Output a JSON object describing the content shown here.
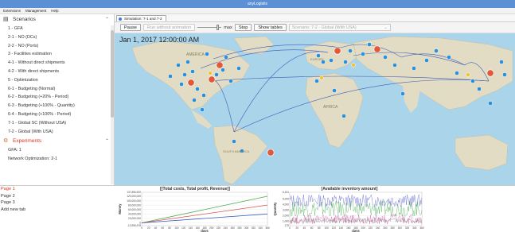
{
  "window": {
    "title": "anyLogistix"
  },
  "menu": [
    "Extensions",
    "Management",
    "Help"
  ],
  "sidebar": {
    "scenarios_header": "Scenarios",
    "scenarios": [
      "1 - GFA",
      "2-1 - NO (DCs)",
      "2-2 - NO (Ports)",
      "3 - Facilities estimation",
      "4-1 - Without direct shipments",
      "4-2 - With direct shipments",
      "5 - Optimization",
      "6-1 - Budgeting (Normal)",
      "6-2 - Budgeting (+20% - Period)",
      "6-3 - Budgeting (+100% - Quantity)",
      "6-4 - Budgeting (+100% - Period)",
      "7-1 - Global SC (Without USA)",
      "7-2 - Global (With USA)"
    ],
    "experiments_header": "Experiments",
    "experiments": [
      "GFA: 1",
      "Network Optimization: 2-1"
    ]
  },
  "sim_tab": {
    "label": "Simulation: 7-1 and 7-2"
  },
  "toolbar": {
    "pause": "Pause",
    "run_without_animation": "Run without animation",
    "max": "max",
    "stop": "Stop",
    "show_tables": "Show tables",
    "scenario_select": "Scenario: 7-2 - Global (With USA)"
  },
  "map": {
    "date": "Jan 1, 2017 12:00:00 AM",
    "labels": {
      "america": "AMERICA",
      "africa": "AFRICA",
      "europe": "EUROPE",
      "america_south": "SOUTH AMERICA"
    }
  },
  "pages": [
    "Page 1",
    "Page 2",
    "Page 3",
    "Add new tab"
  ],
  "chart_data": [
    {
      "type": "line",
      "title": "[[Total costs, Total profit, Revenue]]",
      "xlabel": "days",
      "ylabel": "Money",
      "x": [
        0,
        360
      ],
      "xticks": [
        0,
        20,
        40,
        60,
        80,
        100,
        120,
        140,
        160,
        180,
        200,
        220,
        240,
        260,
        280,
        300,
        320,
        340,
        360
      ],
      "yticks": [
        "-12,596,978",
        "0",
        "20,000,000",
        "40,000,000",
        "60,000,000",
        "80,000,000",
        "100,000,000",
        "120,000,000",
        "137,896,520"
      ],
      "ylim": [
        -12596978,
        137896520
      ],
      "series": [
        {
          "color": "#4cae4c",
          "values": [
            0,
            120000000
          ]
        },
        {
          "color": "#d9534f",
          "values": [
            0,
            80000000
          ]
        },
        {
          "color": "#3b5fc0",
          "values": [
            0,
            40000000
          ]
        }
      ]
    },
    {
      "type": "line",
      "title": "[Available inventory amount]",
      "xlabel": "days",
      "ylabel": "Quantity",
      "xticks": [
        0,
        20,
        40,
        60,
        80,
        100,
        120,
        140,
        160,
        180,
        200,
        220,
        240,
        260,
        280,
        300,
        320,
        340,
        360
      ],
      "yticks": [
        "175",
        "1,000",
        "2,000",
        "3,000",
        "4,000",
        "5,000",
        "6,151"
      ],
      "ylim": [
        175,
        6151
      ],
      "series_colors": [
        "#4a52c8",
        "#3aa64a",
        "#d24fa8",
        "#6b6b6b"
      ]
    }
  ]
}
